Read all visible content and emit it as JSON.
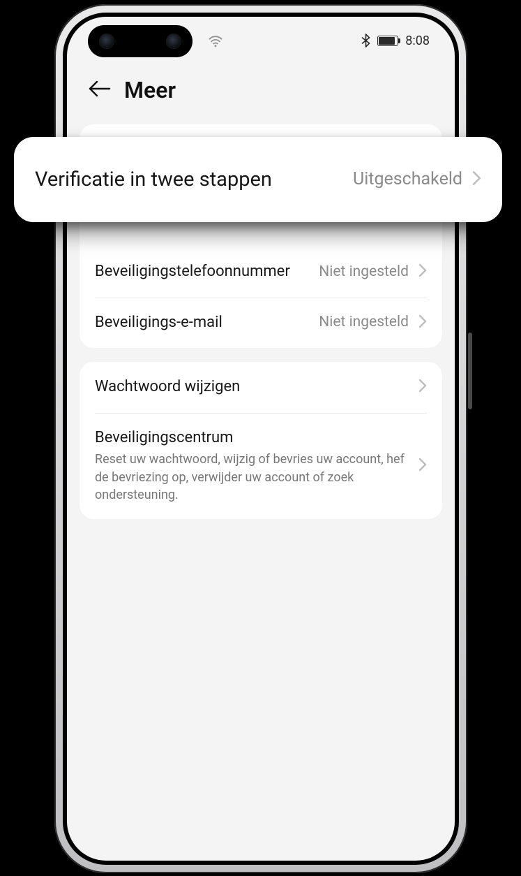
{
  "status_bar": {
    "time": "8:08"
  },
  "header": {
    "title": "Meer"
  },
  "popover": {
    "label": "Verificatie in twee stappen",
    "value": "Uitgeschakeld"
  },
  "group1": {
    "row_phone": {
      "label": "Beveiligingstelefoonnummer",
      "value": "Niet ingesteld"
    },
    "row_email": {
      "label": "Beveiligings-e-mail",
      "value": "Niet ingesteld"
    }
  },
  "group2": {
    "row_password": {
      "label": "Wachtwoord wijzigen"
    },
    "row_center": {
      "label": "Beveiligingscentrum",
      "sub": "Reset uw wachtwoord, wijzig of bevries uw account, hef de bevriezing op, verwijder uw account of zoek ondersteuning."
    }
  }
}
